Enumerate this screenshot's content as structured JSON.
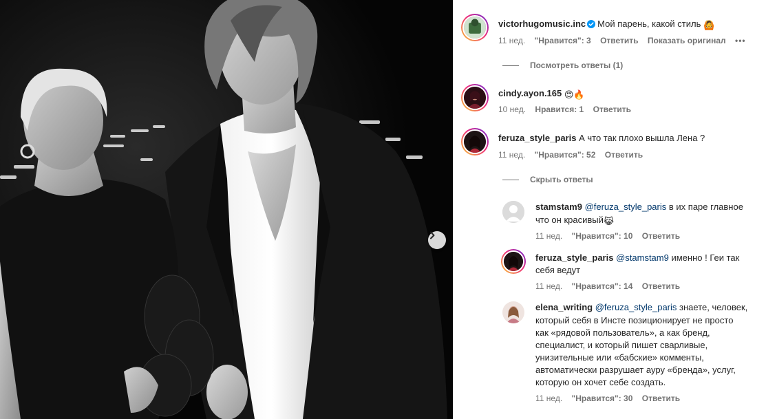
{
  "post": {
    "next_image_button_icon": "chevron-right-icon"
  },
  "comments": [
    {
      "username": "victorhugomusic.inc",
      "verified": true,
      "text": "Мой парень, какой стиль",
      "emoji": "🙆",
      "time": "11 нед.",
      "likes": "\"Нравится\": 3",
      "reply": "Ответить",
      "translate": "Показать оригинал",
      "more": "•••",
      "replies_toggle": "Посмотреть ответы (1)"
    },
    {
      "username": "cindy.ayon.165",
      "text": "",
      "emoji": "😍🔥",
      "time": "10 нед.",
      "likes": "Нравится: 1",
      "reply": "Ответить"
    },
    {
      "username": "feruza_style_paris",
      "text": "А что так плохо вышла Лена ?",
      "time": "11 нед.",
      "likes": "\"Нравится\": 52",
      "reply": "Ответить",
      "replies_toggle": "Скрыть ответы"
    }
  ],
  "replies": [
    {
      "username": "stamstam9",
      "mention": "@feruza_style_paris",
      "text_line1": "в их паре главное",
      "text_line2": "что он красивый",
      "emoji": "😹",
      "time": "11 нед.",
      "likes": "\"Нравится\": 10",
      "reply": "Ответить"
    },
    {
      "username": "feruza_style_paris",
      "mention": "@stamstam9",
      "text_line1": "именно ! Геи так",
      "text_line2": "себя ведут",
      "time": "11 нед.",
      "likes": "\"Нравится\": 14",
      "reply": "Ответить"
    },
    {
      "username": "elena_writing",
      "mention": "@feruza_style_paris",
      "text_line1": "знаете, человек,",
      "lines": [
        "который себя в Инсте позиционирует не просто",
        "как «рядовой пользователь», а как бренд,",
        "специалист, и который пишет сварливые,",
        "унизительные или «бабские» комменты,",
        "автоматически разрушает ауру «бренда», услуг,",
        "которую он хочет себе создать."
      ],
      "time": "11 нед.",
      "likes": "\"Нравится\": 30",
      "reply": "Ответить"
    }
  ],
  "colors": {
    "text": "#262626",
    "secondary": "#737373",
    "mention": "#00376b",
    "verified": "#0095f6"
  }
}
